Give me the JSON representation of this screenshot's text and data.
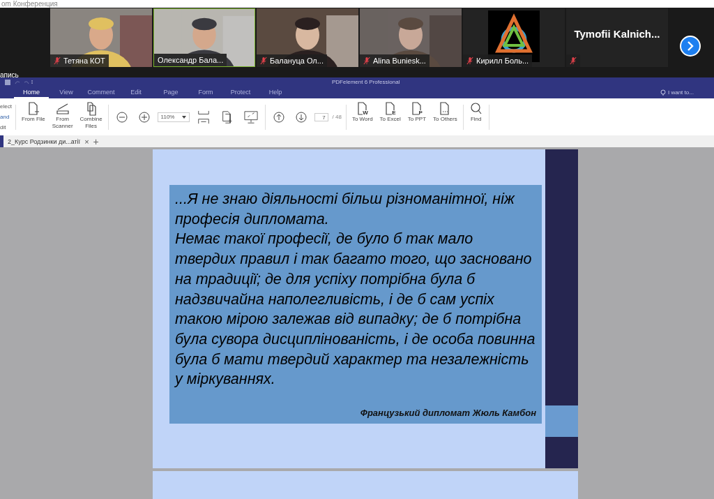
{
  "app_title": "om Конференция",
  "participants": [
    {
      "kind": "video",
      "name": "Тетяна КОТ",
      "muted": true,
      "active": false
    },
    {
      "kind": "video",
      "name": "Олександр Бала...",
      "muted": false,
      "active": true
    },
    {
      "kind": "video",
      "name": "Балануца Ол...",
      "muted": true,
      "active": false
    },
    {
      "kind": "video",
      "name": "Alina Buniesk...",
      "muted": true,
      "active": false
    },
    {
      "kind": "avatar",
      "name": "Кирилл Боль...",
      "muted": true,
      "active": false
    },
    {
      "kind": "name",
      "name": "Tymofii  Kalnich...",
      "muted": true,
      "active": false
    }
  ],
  "recording_label": "апись",
  "pdf": {
    "title": "PDFelement 6 Professional",
    "help": "I want to...",
    "menu": [
      {
        "label": "Home",
        "selected": true
      },
      {
        "label": "View",
        "selected": false
      },
      {
        "label": "Comment",
        "selected": false
      },
      {
        "label": "Edit",
        "selected": false
      },
      {
        "label": "Page",
        "selected": false
      },
      {
        "label": "Form",
        "selected": false
      },
      {
        "label": "Protect",
        "selected": false
      },
      {
        "label": "Help",
        "selected": false
      }
    ],
    "left_labels": [
      "elect",
      "and",
      "dit"
    ],
    "create_buttons": [
      {
        "kind": "file",
        "label": "From File"
      },
      {
        "kind": "scanner",
        "label": "From\nScanner"
      },
      {
        "kind": "combine",
        "label": "Combine\nFiles"
      }
    ],
    "zoom": "110%",
    "page": "7",
    "page_total": "/ 48",
    "convert_buttons": [
      {
        "letter": "W",
        "label": "To Word"
      },
      {
        "letter": "E",
        "label": "To Excel"
      },
      {
        "letter": "P",
        "label": "To PPT"
      },
      {
        "label": "To Others"
      }
    ],
    "find": "Find",
    "document_tab": "2_Курс Родзинки ди...атії",
    "close": "×",
    "add": "+"
  },
  "slide": {
    "quote": [
      "...Я не знаю діяльності більш різноманітної, ніж професія дипломата.",
      "Немає такої професії, де було б так мало твердих правил і так багато того, що засновано на традиції; де для успіху потрібна була б надзвичайна наполегливість, і де б сам успіх такою мірою залежав від випадку; де б потрібна була сувора дисциплінованість, і де особа повинна була б мати твердий характер та незалежність у міркуваннях."
    ],
    "attribution": "Французький дипломат Жюль Камбон"
  }
}
